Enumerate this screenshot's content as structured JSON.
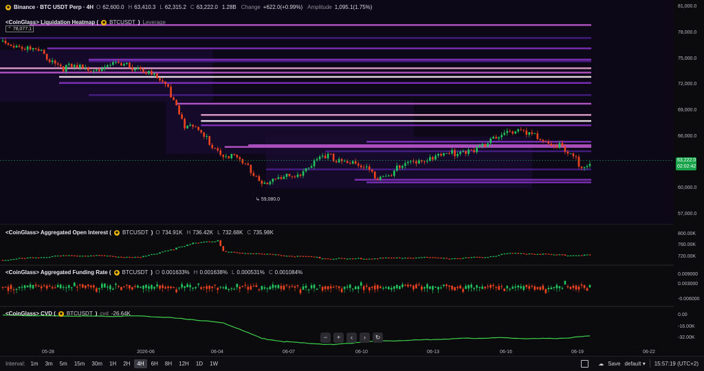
{
  "header": {
    "exchange": "Binance · BTC USDT Perp · 4H",
    "ohlc": [
      {
        "key": "O",
        "value": "62,600.0"
      },
      {
        "key": "H",
        "value": "63,410.3"
      },
      {
        "key": "L",
        "value": "62,315.2"
      },
      {
        "key": "C",
        "value": "63,222.0"
      },
      {
        "key": "",
        "value": "1.28B"
      }
    ],
    "change_label": "Change",
    "change_value": "+622.0(+0.99%)",
    "amplitude_label": "Amplitude",
    "amplitude_value": "1,095.1(1.75%)"
  },
  "panes": {
    "heatmap": {
      "title": "<CoinGlass> Liquidation Heatmap (",
      "symbol": "BTCUSDT",
      "close": ")",
      "extra": "Leverage"
    },
    "oi": {
      "title": "<CoinGlass> Aggregated Open Interest (",
      "symbol": "BTCUSDT",
      "close": ")",
      "ohlc": [
        {
          "key": "O",
          "value": "734.91K"
        },
        {
          "key": "H",
          "value": "736.42K"
        },
        {
          "key": "L",
          "value": "732.68K"
        },
        {
          "key": "C",
          "value": "735.98K"
        }
      ]
    },
    "funding": {
      "title": "<CoinGlass> Aggregated Funding Rate (",
      "symbol": "BTCUSDT",
      "close": ")",
      "ohlc": [
        {
          "key": "O",
          "value": "0.001633%"
        },
        {
          "key": "H",
          "value": "0.001638%"
        },
        {
          "key": "L",
          "value": "0.000531%"
        },
        {
          "key": "C",
          "value": "0.001084%"
        }
      ]
    },
    "cvd": {
      "title": "<CoinGlass> CVD (",
      "symbol": "BTCUSDT",
      "close": ")",
      "label": "cvd",
      "value": "-26.64K"
    }
  },
  "annotations": {
    "high": "78,077.1",
    "low": "59,080.0"
  },
  "price_badge": {
    "price": "63,222.0",
    "countdown": "02:02:42"
  },
  "axes": {
    "price_ticks": [
      "81,000.0",
      "78,000.0",
      "75,000.0",
      "72,000.0",
      "69,000.0",
      "66,000.0",
      "60,000.0",
      "57,000.0"
    ],
    "oi_ticks": [
      "800.00K",
      "760.00K",
      "720.00K"
    ],
    "funding_ticks": [
      "0.009000",
      "0.003000",
      "-0.006000"
    ],
    "cvd_ticks": [
      "0.00",
      "-16.00K",
      "-32.00K"
    ],
    "time_ticks": [
      "05-28",
      "2026-06",
      "06-04",
      "06-07",
      "06-10",
      "06-13",
      "06-16",
      "06-19",
      "06-22"
    ]
  },
  "nav": {
    "zoom_out": "−",
    "zoom_in": "+",
    "scroll_left": "‹",
    "scroll_right": "›",
    "reset": "↻"
  },
  "toolbar": {
    "interval_label": "Interval:",
    "intervals": [
      "1m",
      "3m",
      "5m",
      "15m",
      "30m",
      "1H",
      "2H",
      "4H",
      "6H",
      "8H",
      "12H",
      "1D",
      "1W"
    ],
    "active_interval": "4H",
    "save": "Save",
    "layout": "default",
    "clock": "15:57:19 (UTC+2)"
  },
  "colors": {
    "up": "#22c55e",
    "down": "#ef4420",
    "heat_low": "#4b1f8c",
    "heat_high": "#f4a8d8",
    "cvd_line": "#3fd14b"
  },
  "icons": {
    "coin": "binance-coin-icon",
    "fullscreen": "fullscreen-icon",
    "save": "cloud-save-icon"
  },
  "chart_data": {
    "type": "candlestick",
    "x": [
      "05-28",
      "2026-06",
      "06-04",
      "06-07",
      "06-10",
      "06-13",
      "06-16",
      "06-19",
      "06-22"
    ],
    "price_range": [
      57000,
      81000
    ],
    "annotations": {
      "high": 78077.1,
      "low": 59080.0,
      "last": 63222.0
    },
    "price_path": [
      [
        0,
        77000
      ],
      [
        6,
        76500
      ],
      [
        14,
        75600
      ],
      [
        22,
        74000
      ],
      [
        30,
        73800
      ],
      [
        40,
        74200
      ],
      [
        48,
        74100
      ],
      [
        52,
        73600
      ],
      [
        56,
        72600
      ],
      [
        60,
        71500
      ],
      [
        64,
        69000
      ],
      [
        66,
        67400
      ],
      [
        70,
        66800
      ],
      [
        74,
        65700
      ],
      [
        78,
        64400
      ],
      [
        84,
        63500
      ],
      [
        90,
        62200
      ],
      [
        94,
        60700
      ],
      [
        100,
        61000
      ],
      [
        106,
        61500
      ],
      [
        112,
        62800
      ],
      [
        118,
        63600
      ],
      [
        124,
        63300
      ],
      [
        130,
        62400
      ],
      [
        136,
        61500
      ],
      [
        142,
        62000
      ],
      [
        148,
        63000
      ],
      [
        154,
        63600
      ],
      [
        160,
        63800
      ],
      [
        166,
        64300
      ],
      [
        172,
        64700
      ],
      [
        176,
        64800
      ],
      [
        178,
        65800
      ],
      [
        182,
        66800
      ],
      [
        186,
        66700
      ],
      [
        190,
        66200
      ],
      [
        194,
        65800
      ],
      [
        198,
        65400
      ],
      [
        202,
        64800
      ],
      [
        206,
        63600
      ],
      [
        210,
        62800
      ],
      [
        213,
        63200
      ]
    ],
    "liquidation_levels": [
      {
        "price": 78900,
        "intensity": 0.65,
        "start": 0.05
      },
      {
        "price": 77400,
        "intensity": 0.3,
        "start": 0.0
      },
      {
        "price": 76200,
        "intensity": 0.45,
        "start": 0.08
      },
      {
        "price": 74900,
        "intensity": 0.55,
        "start": 0.15
      },
      {
        "price": 74700,
        "intensity": 0.4,
        "start": 0.15
      },
      {
        "price": 73900,
        "intensity": 0.85,
        "start": 0.0
      },
      {
        "price": 73400,
        "intensity": 0.6,
        "start": 0.0
      },
      {
        "price": 72900,
        "intensity": 0.95,
        "start": 0.1
      },
      {
        "price": 72200,
        "intensity": 0.5,
        "start": 0.1
      },
      {
        "price": 70800,
        "intensity": 0.35,
        "start": 0.15
      },
      {
        "price": 69800,
        "intensity": 0.6,
        "start": 0.3
      },
      {
        "price": 68500,
        "intensity": 0.85,
        "start": 0.34
      },
      {
        "price": 67800,
        "intensity": 1.0,
        "start": 0.34
      },
      {
        "price": 67300,
        "intensity": 0.45,
        "start": 0.34
      },
      {
        "price": 65400,
        "intensity": 0.5,
        "start": 0.62
      },
      {
        "price": 65000,
        "intensity": 0.7,
        "start": 0.42
      },
      {
        "price": 64800,
        "intensity": 0.75,
        "start": 0.38
      },
      {
        "price": 64300,
        "intensity": 0.35,
        "start": 0.55
      },
      {
        "price": 62200,
        "intensity": 0.3,
        "start": 0.45
      },
      {
        "price": 61000,
        "intensity": 0.45,
        "start": 0.6
      },
      {
        "price": 60700,
        "intensity": 0.5,
        "start": 0.62
      }
    ],
    "open_interest_range": [
      700000,
      820000
    ],
    "open_interest_path": [
      [
        0,
        715000
      ],
      [
        14,
        728000
      ],
      [
        30,
        734000
      ],
      [
        40,
        730000
      ],
      [
        50,
        726000
      ],
      [
        60,
        755000
      ],
      [
        66,
        770000
      ],
      [
        70,
        785000
      ],
      [
        74,
        790000
      ],
      [
        78,
        792000
      ],
      [
        80,
        748000
      ],
      [
        90,
        742000
      ],
      [
        100,
        735000
      ],
      [
        110,
        728000
      ],
      [
        118,
        722000
      ],
      [
        124,
        720000
      ],
      [
        136,
        722000
      ],
      [
        150,
        726000
      ],
      [
        166,
        722000
      ],
      [
        176,
        728000
      ],
      [
        182,
        740000
      ],
      [
        190,
        742000
      ],
      [
        200,
        735000
      ],
      [
        213,
        735000
      ]
    ],
    "funding_range": [
      -0.01,
      0.012
    ],
    "cvd_range": [
      -40000,
      6000
    ],
    "cvd_path": [
      [
        0,
        0
      ],
      [
        20,
        -1000
      ],
      [
        40,
        -1500
      ],
      [
        50,
        -1000
      ],
      [
        60,
        -3000
      ],
      [
        70,
        -6000
      ],
      [
        80,
        -10000
      ],
      [
        86,
        -18000
      ],
      [
        94,
        -30000
      ],
      [
        102,
        -34000
      ],
      [
        110,
        -36000
      ],
      [
        120,
        -38000
      ],
      [
        132,
        -34000
      ],
      [
        150,
        -32000
      ],
      [
        166,
        -30000
      ],
      [
        180,
        -29000
      ],
      [
        190,
        -30000
      ],
      [
        200,
        -30000
      ],
      [
        206,
        -29000
      ],
      [
        213,
        -26640
      ]
    ]
  }
}
